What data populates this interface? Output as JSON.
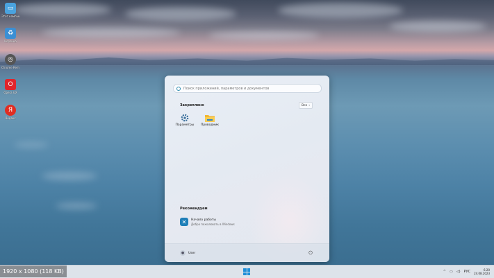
{
  "desktop": {
    "icons": [
      {
        "name": "Этот компьютер",
        "icon": "monitor-icon",
        "color": "#4aa3df"
      },
      {
        "name": "Корзина",
        "icon": "recycle-bin-icon",
        "color": "#3b8fd4"
      },
      {
        "name": "Chrome Remote Desktop",
        "icon": "remote-desktop-icon",
        "color": "#555555"
      },
      {
        "name": "Opera GX",
        "icon": "opera-icon",
        "color": "#e0252c"
      },
      {
        "name": "Яндекс",
        "icon": "yandex-icon",
        "color": "#e02d22"
      }
    ]
  },
  "start_menu": {
    "search": {
      "placeholder": "Поиск приложений, параметров и документов"
    },
    "pinned": {
      "title": "Закреплено",
      "all_button": "Все",
      "apps": [
        {
          "label": "Параметры",
          "icon": "gear-icon"
        },
        {
          "label": "Проводник",
          "icon": "folder-icon"
        }
      ]
    },
    "recommended": {
      "title": "Рекомендуем",
      "items": [
        {
          "title": "Начало работы",
          "subtitle": "Добро пожаловать в Windows",
          "icon": "get-started-icon"
        }
      ]
    },
    "footer": {
      "user_name": "User",
      "power_icon": "power-icon"
    }
  },
  "caption": {
    "text": "1920 x 1080 (118 KB)"
  },
  "taskbar": {
    "tray": {
      "lang": "РУС",
      "time": "6:20",
      "date": "24.08.2023"
    }
  },
  "colors": {
    "accent": "#1f8fd8"
  }
}
